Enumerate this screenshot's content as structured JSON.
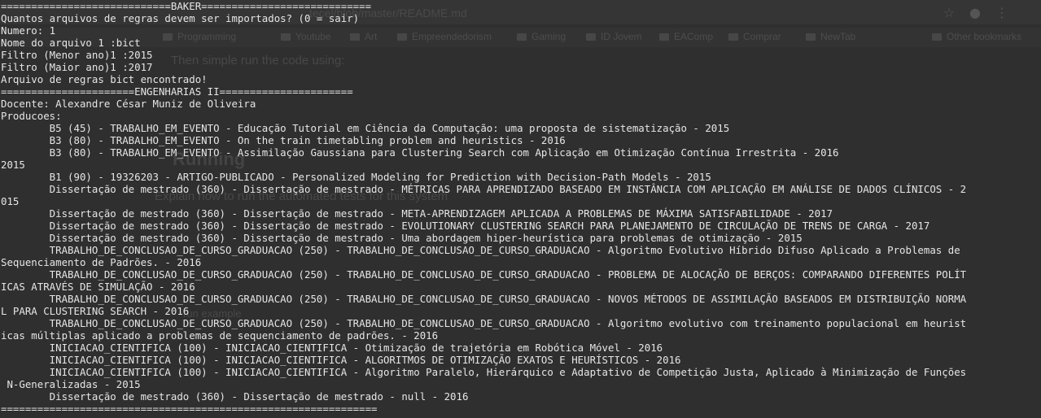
{
  "background_browser": {
    "url_fragment": "tecel/blob/master/README.md",
    "bookmarks": [
      {
        "label": "Programming"
      },
      {
        "label": "Youtube"
      },
      {
        "label": "Art"
      },
      {
        "label": "Empreendedorism"
      },
      {
        "label": "Gaming"
      },
      {
        "label": "ID Jovem"
      },
      {
        "label": "EAComp"
      },
      {
        "label": "Comprar"
      },
      {
        "label": "NewTab"
      },
      {
        "label": "Other bookmarks"
      }
    ],
    "text_run_code": "Then simple run the code using:",
    "heading_running": "Running",
    "text_explain": "Explain how to run the automated tests for this system",
    "text_example": "run example"
  },
  "terminal": {
    "lines": [
      "============================BAKER============================",
      "Quantos arquivos de regras devem ser importados? (0 = sair)",
      "Numero: 1",
      "Nome do arquivo 1 :bict",
      "Filtro (Menor ano)1 :2015",
      "Filtro (Maior ano)1 :2017",
      "Arquivo de regras bict encontrado!",
      "======================ENGENHARIAS II======================",
      "Docente: Alexandre César Muniz de Oliveira",
      "Producoes:",
      "        B5 (45) - TRABALHO_EM_EVENTO - Educação Tutorial em Ciência da Computação: uma proposta de sistematização - 2015",
      "        B3 (80) - TRABALHO_EM_EVENTO - On the train timetabling problem and heuristics - 2016",
      "        B3 (80) - TRABALHO_EM_EVENTO - Assimilação Gaussiana para Clustering Search com Aplicação em Otimização Contínua Irrestrita - 2016",
      "2015",
      "        B1 (90) - 19326203 - ARTIGO-PUBLICADO - Personalized Modeling for Prediction with Decision-Path Models - 2015",
      "        Dissertação de mestrado (360) - Dissertação de mestrado - MÉTRICAS PARA APRENDIZADO BASEADO EM INSTÂNCIA COM APLICAÇÃO EM ANÁLISE DE DADOS CLÍNICOS - 2",
      "015",
      "        Dissertação de mestrado (360) - Dissertação de mestrado - META-APRENDIZAGEM APLICADA A PROBLEMAS DE MÁXIMA SATISFABILIDADE - 2017",
      "        Dissertação de mestrado (360) - Dissertação de mestrado - EVOLUTIONARY CLUSTERING SEARCH PARA PLANEJAMENTO DE CIRCULAÇÃO DE TRENS DE CARGA - 2017",
      "        Dissertação de mestrado (360) - Dissertação de mestrado - Uma abordagem hiper-heurística para problemas de otimização - 2015",
      "        TRABALHO_DE_CONCLUSAO_DE_CURSO_GRADUACAO (250) - TRABALHO_DE_CONCLUSAO_DE_CURSO_GRADUACAO - Algoritmo Evolutivo Híbrido Difuso Aplicado a Problemas de",
      "Sequenciamento de Padrões. - 2016",
      "        TRABALHO_DE_CONCLUSAO_DE_CURSO_GRADUACAO (250) - TRABALHO_DE_CONCLUSAO_DE_CURSO_GRADUACAO - PROBLEMA DE ALOCAÇÃO DE BERÇOS: COMPARANDO DIFERENTES POLÍT",
      "ICAS ATRAVÉS DE SIMULAÇÃO - 2016",
      "        TRABALHO_DE_CONCLUSAO_DE_CURSO_GRADUACAO (250) - TRABALHO_DE_CONCLUSAO_DE_CURSO_GRADUACAO - NOVOS MÉTODOS DE ASSIMILAÇÃO BASEADOS EM DISTRIBUIÇÃO NORMA",
      "L PARA CLUSTERING SEARCH - 2016",
      "        TRABALHO_DE_CONCLUSAO_DE_CURSO_GRADUACAO (250) - TRABALHO_DE_CONCLUSAO_DE_CURSO_GRADUACAO - Algoritmo evolutivo com treinamento populacional em heurist",
      "icas múltiplas aplicado a problemas de sequenciamento de padrões. - 2016",
      "        INICIACAO_CIENTIFICA (100) - INICIACAO_CIENTIFICA - Otimização de trajetória em Robótica Móvel - 2016",
      "        INICIACAO_CIENTIFICA (100) - INICIACAO_CIENTIFICA - ALGORITMOS DE OTIMIZAÇÃO EXATOS E HEURÍSTICOS - 2016",
      "        INICIACAO_CIENTIFICA (100) - INICIACAO_CIENTIFICA - Algoritmo Paralelo, Hierárquico e Adaptativo de Competição Justa, Aplicado à Minimização de Funções",
      " N-Generalizadas - 2015",
      "        Dissertação de mestrado (360) - Dissertação de mestrado - null - 2016",
      "=============================================================="
    ]
  }
}
